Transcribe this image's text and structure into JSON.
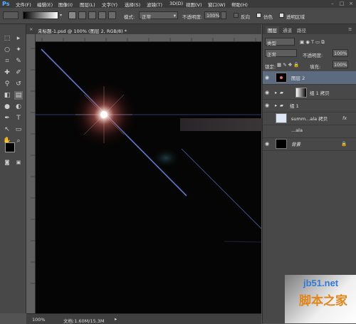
{
  "app": {
    "logo": "Ps"
  },
  "menu": [
    "文件(F)",
    "编辑(E)",
    "图像(I)",
    "图层(L)",
    "文字(Y)",
    "选择(S)",
    "滤镜(T)",
    "3D(D)",
    "视图(V)",
    "窗口(W)",
    "帮助(H)"
  ],
  "options": {
    "mode_label": "模式:",
    "mode_value": "正常",
    "opacity_label": "不透明度:",
    "opacity_value": "100%",
    "reverse_label": "反向",
    "dither_label": "仿色",
    "transparency_label": "透明区域"
  },
  "document": {
    "tab_title": "未标题-1.psd @ 100% (图层 2, RGB/8) *",
    "zoom": "100%",
    "doc_size": "文档:1.60M/15.3M"
  },
  "colors": {
    "accent": "#5ab1ff",
    "selected_layer": "#5c6b80",
    "canvas": "#060505",
    "flare_core": "#ffffff",
    "flare_glow": "#c2605a",
    "streak": "#5f78c8"
  },
  "layers_panel": {
    "tabs": [
      "图层",
      "通道",
      "路径"
    ],
    "filter_label": "类型",
    "blend_mode": "正常",
    "opacity_label": "不透明度:",
    "opacity_value": "100%",
    "lock_label": "锁定:",
    "fill_label": "填充:",
    "fill_value": "100%",
    "layers": [
      {
        "name": "图层 2",
        "selected": true,
        "type": "layer"
      },
      {
        "name": "组 1 拷贝",
        "selected": false,
        "type": "group"
      },
      {
        "name": "组 1",
        "selected": false,
        "type": "group"
      },
      {
        "name": "summ...ala 拷贝",
        "selected": false,
        "type": "smart"
      },
      {
        "name": "...ala",
        "selected": false,
        "type": "smart"
      },
      {
        "name": "背景",
        "selected": false,
        "type": "background"
      }
    ]
  },
  "watermark": {
    "site": "jb51.net",
    "brand": "脚本之家"
  }
}
